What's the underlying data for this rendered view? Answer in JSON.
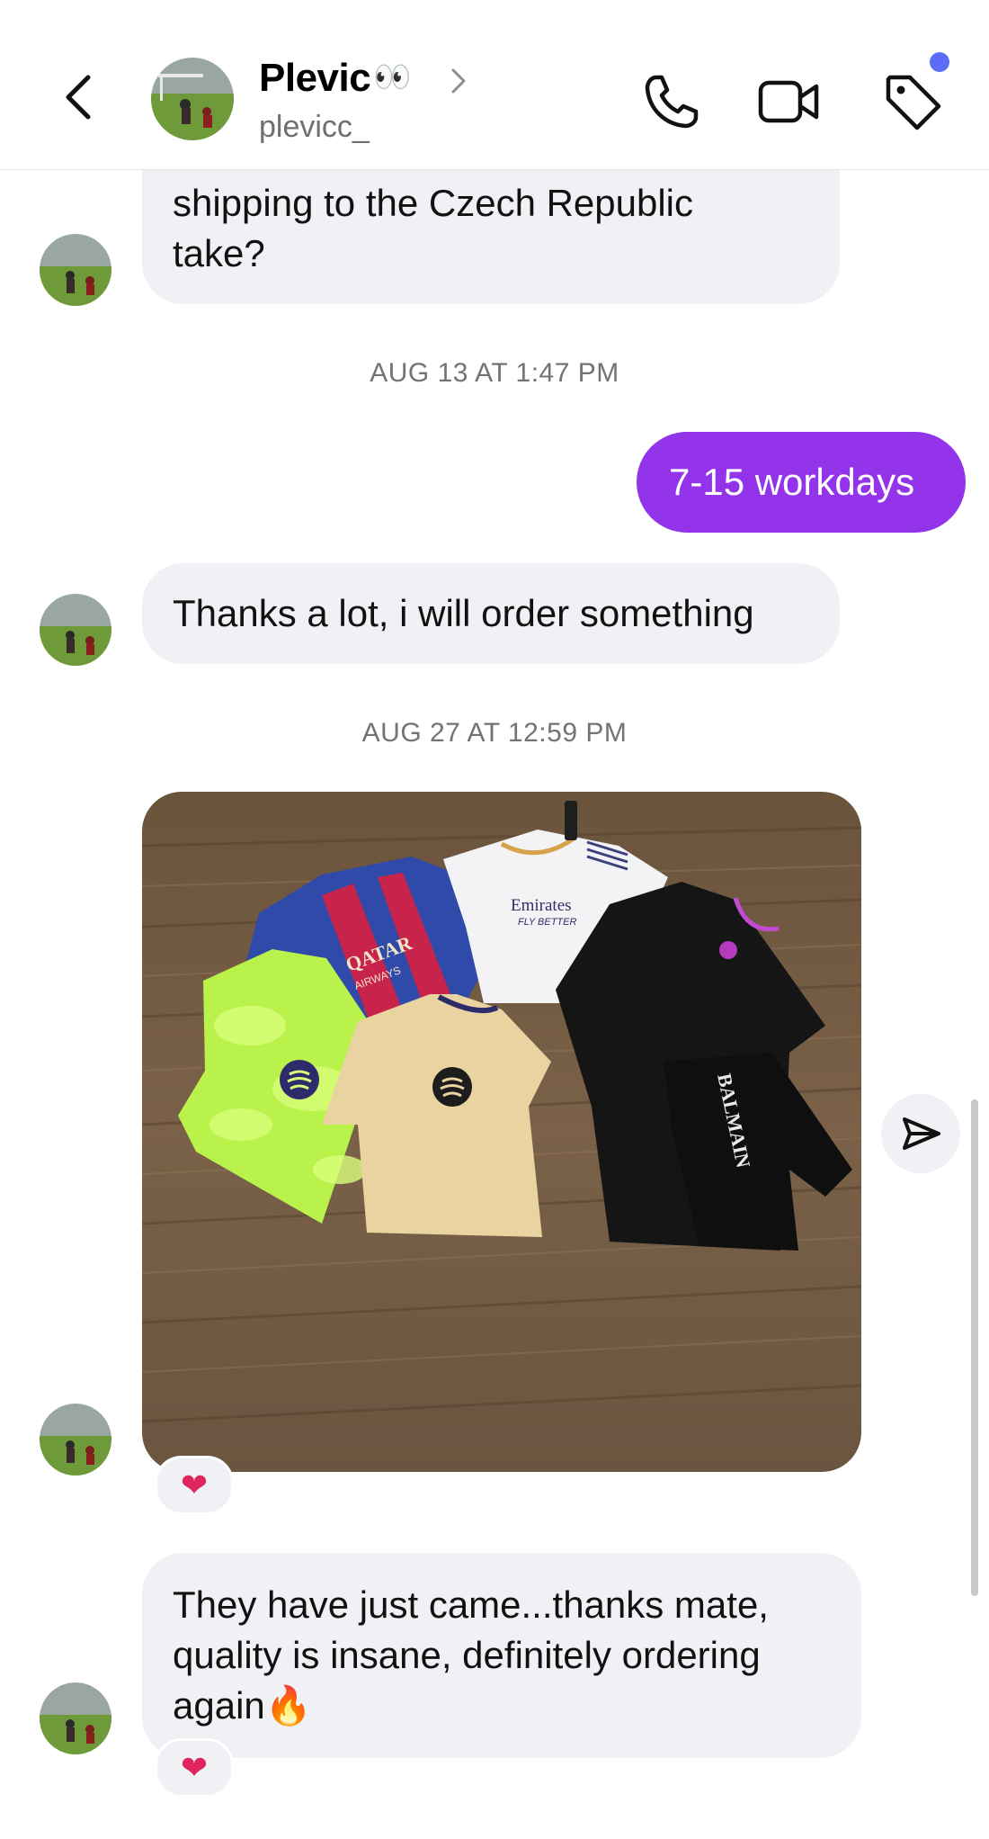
{
  "header": {
    "name": "Plevic",
    "name_emoji": "👀",
    "username": "plevicc_",
    "icons": [
      "back-chevron-icon",
      "chevron-right-icon",
      "phone-icon",
      "video-camera-icon",
      "tag-icon"
    ],
    "notification_dot_color": "#5b6cf7"
  },
  "messages": {
    "m1_line1": "shipping to the Czech Republic",
    "m1_line2": "take?",
    "ts1": "AUG 13 AT 1:47 PM",
    "m2": "7-15 workdays",
    "m3": "Thanks a lot, i will order something",
    "ts2": "AUG 27 AT 12:59 PM",
    "m4_line1": "They have just came...thanks mate,",
    "m4_line2": "quality is insane, definitely ordering",
    "m4_line3": "again",
    "m4_emoji": "🔥",
    "reaction1": "❤",
    "reaction2": "❤"
  },
  "photo": {
    "texts": [
      "QATAR AIRWAYS",
      "Emirates",
      "FLY BETTER",
      "BALMAIN"
    ]
  },
  "colors": {
    "outgoing_bubble": "#9333ea",
    "incoming_bubble": "#eff1f5"
  }
}
